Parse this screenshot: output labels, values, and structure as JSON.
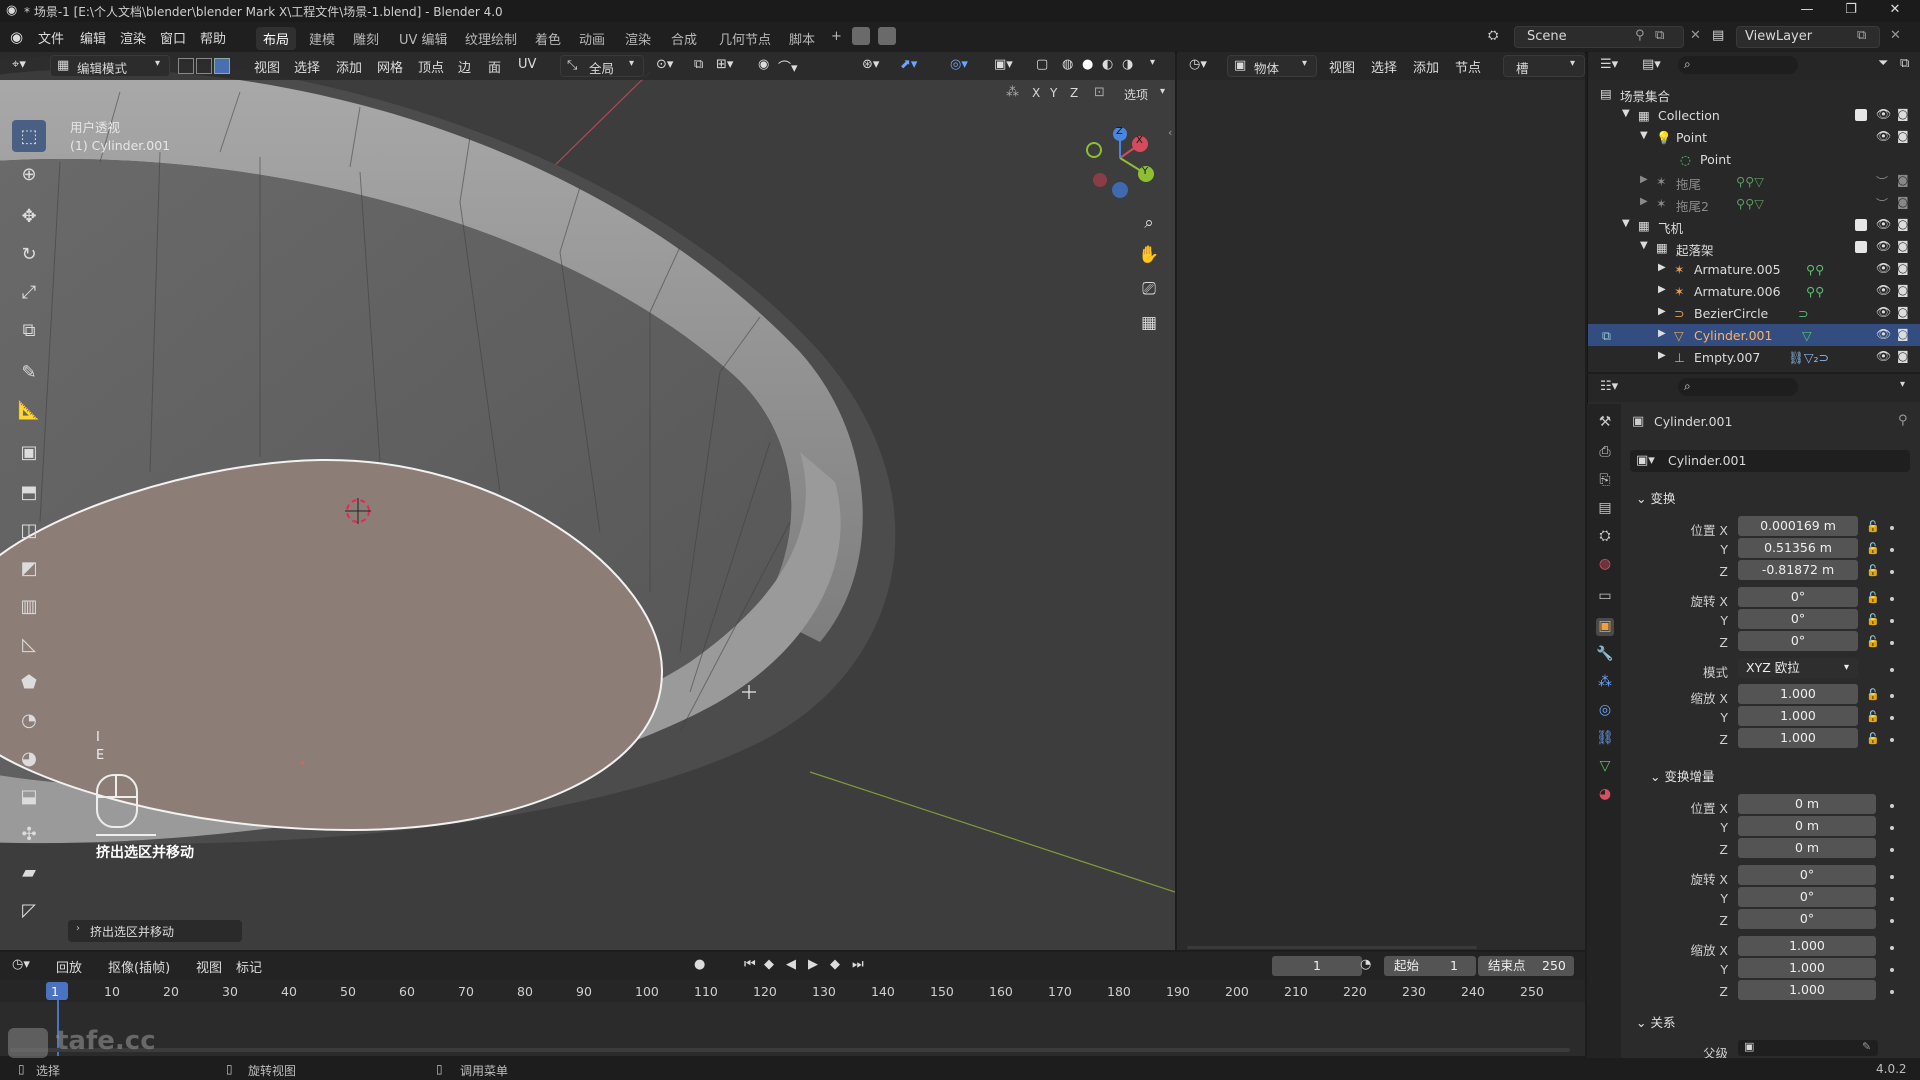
{
  "window": {
    "title": "* 场景-1 [E:\\个人文档\\blender\\blender Mark X\\工程文件\\场景-1.blend] - Blender 4.0",
    "minimize": "—",
    "maximize": "❐",
    "close": "✕"
  },
  "menu": {
    "items": [
      "文件",
      "编辑",
      "渲染",
      "窗口",
      "帮助"
    ],
    "workspaces": [
      "布局",
      "建模",
      "雕刻",
      "UV 编辑",
      "纹理绘制",
      "着色",
      "动画",
      "渲染",
      "合成",
      "几何节点",
      "脚本"
    ],
    "add_tab": "+",
    "scene_label": "Scene",
    "view_layer_label": "ViewLayer"
  },
  "viewport": {
    "mode": "编辑模式",
    "menus": [
      "视图",
      "选择",
      "添加",
      "网格",
      "顶点",
      "边",
      "面",
      "UV"
    ],
    "transform_orientation": "全局",
    "view_name": "用户透视",
    "object_name": "(1) Cylinder.001",
    "axis_labels": [
      "X",
      "Y",
      "Z"
    ],
    "options_label": "选项",
    "gizmo": {
      "x": "X",
      "y": "Y",
      "z": "Z"
    },
    "keycast_key_i": "I",
    "keycast_key_e": "E",
    "keycast_action": "挤出选区并移动",
    "operator_panel": "挤出选区并移动"
  },
  "mid_header": {
    "object_mode": "物体",
    "menus": [
      "视图",
      "选择",
      "添加",
      "节点"
    ],
    "slot": "槽"
  },
  "outliner": {
    "root": "场景集合",
    "items": [
      {
        "label": "Collection",
        "indent": 0,
        "checked": true
      },
      {
        "label": "Point",
        "indent": 1
      },
      {
        "label": "Point",
        "indent": 2
      },
      {
        "label": "拖尾",
        "indent": 1,
        "hidden": true
      },
      {
        "label": "拖尾2",
        "indent": 1,
        "hidden": true
      },
      {
        "label": "飞机",
        "indent": 0,
        "checked": true
      },
      {
        "label": "起落架",
        "indent": 1,
        "checked": true
      },
      {
        "label": "Armature.005",
        "indent": 2
      },
      {
        "label": "Armature.006",
        "indent": 2
      },
      {
        "label": "BezierCircle",
        "indent": 2
      },
      {
        "label": "Cylinder.001",
        "indent": 2,
        "selected": true
      },
      {
        "label": "Empty.007",
        "indent": 2
      }
    ]
  },
  "properties": {
    "object_name": "Cylinder.001",
    "data_name": "Cylinder.001",
    "transform_section": "变换",
    "location_label": "位置 X",
    "location": [
      "0.000169 m",
      "0.51356 m",
      "-0.81872 m"
    ],
    "rotation_label": "旋转 X",
    "rotation": [
      "0°",
      "0°",
      "0°"
    ],
    "mode_label": "模式",
    "mode_value": "XYZ 欧拉",
    "scale_label": "缩放 X",
    "scale": [
      "1.000",
      "1.000",
      "1.000"
    ],
    "delta_section": "变换增量",
    "delta_location": [
      "0 m",
      "0 m",
      "0 m"
    ],
    "delta_rotation": [
      "0°",
      "0°",
      "0°"
    ],
    "delta_scale": [
      "1.000",
      "1.000",
      "1.000"
    ],
    "relations_section": "关系",
    "parent_label": "父级",
    "axis_y": "Y",
    "axis_z": "Z"
  },
  "timeline": {
    "menus": [
      "回放",
      "抠像(插帧)",
      "视图",
      "标记"
    ],
    "current_frame": "1",
    "start_label": "起始",
    "start_value": "1",
    "end_label": "结束点",
    "end_value": "250",
    "ticks": [
      "1",
      "10",
      "20",
      "30",
      "40",
      "50",
      "60",
      "70",
      "80",
      "90",
      "100",
      "110",
      "120",
      "130",
      "140",
      "150",
      "160",
      "170",
      "180",
      "190",
      "200",
      "210",
      "220",
      "230",
      "240",
      "250"
    ]
  },
  "status": {
    "select": "选择",
    "rotate_view": "旋转视图",
    "call_menu": "调用菜单",
    "version": "4.0.2"
  },
  "watermark": "tafe.cc",
  "colors": {
    "accent_blue": "#4a6fb0",
    "selection_face": "#8a7a74",
    "viewport_bg": "#3d3d3d"
  }
}
